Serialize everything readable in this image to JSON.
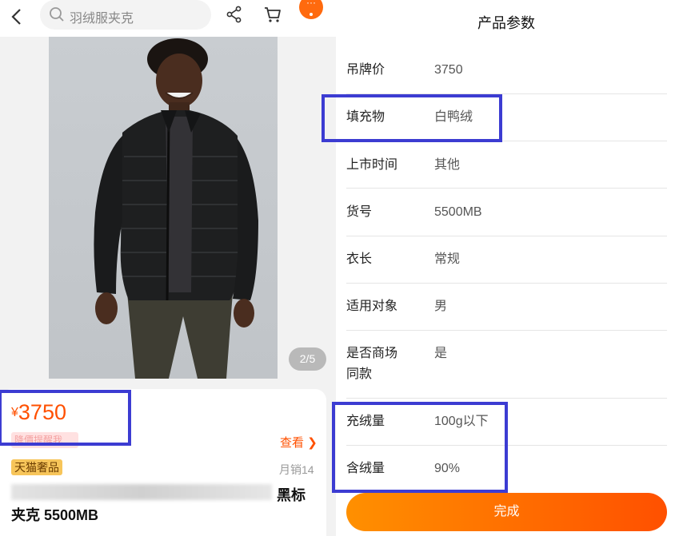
{
  "header": {
    "search_placeholder": "羽绒服夹克",
    "more_label": "···"
  },
  "gallery": {
    "page_indicator": "2/5"
  },
  "product": {
    "currency": "¥",
    "price": "3750",
    "hidden_label": "降價提醒我",
    "view_link": "查看",
    "store_badge": "天猫奢品",
    "monthly_sales": "月销14",
    "title_suffix": "黑标",
    "title_line2": "夹克 5500MB"
  },
  "specs": {
    "title": "产品参数",
    "rows": [
      {
        "key": "吊牌价",
        "value": "3750"
      },
      {
        "key": "填充物",
        "value": "白鸭绒"
      },
      {
        "key": "上市时间",
        "value": "其他"
      },
      {
        "key": "货号",
        "value": "5500MB"
      },
      {
        "key": "衣长",
        "value": "常规"
      },
      {
        "key": "适用对象",
        "value": "男"
      },
      {
        "key": "是否商场",
        "key_line2": "同款",
        "value": "是"
      },
      {
        "key": "充绒量",
        "value": "100g以下"
      },
      {
        "key": "含绒量",
        "value": "90%"
      }
    ],
    "done_label": "完成"
  },
  "colors": {
    "accent": "#ff5000",
    "highlight_box": "#3c3cd2"
  }
}
